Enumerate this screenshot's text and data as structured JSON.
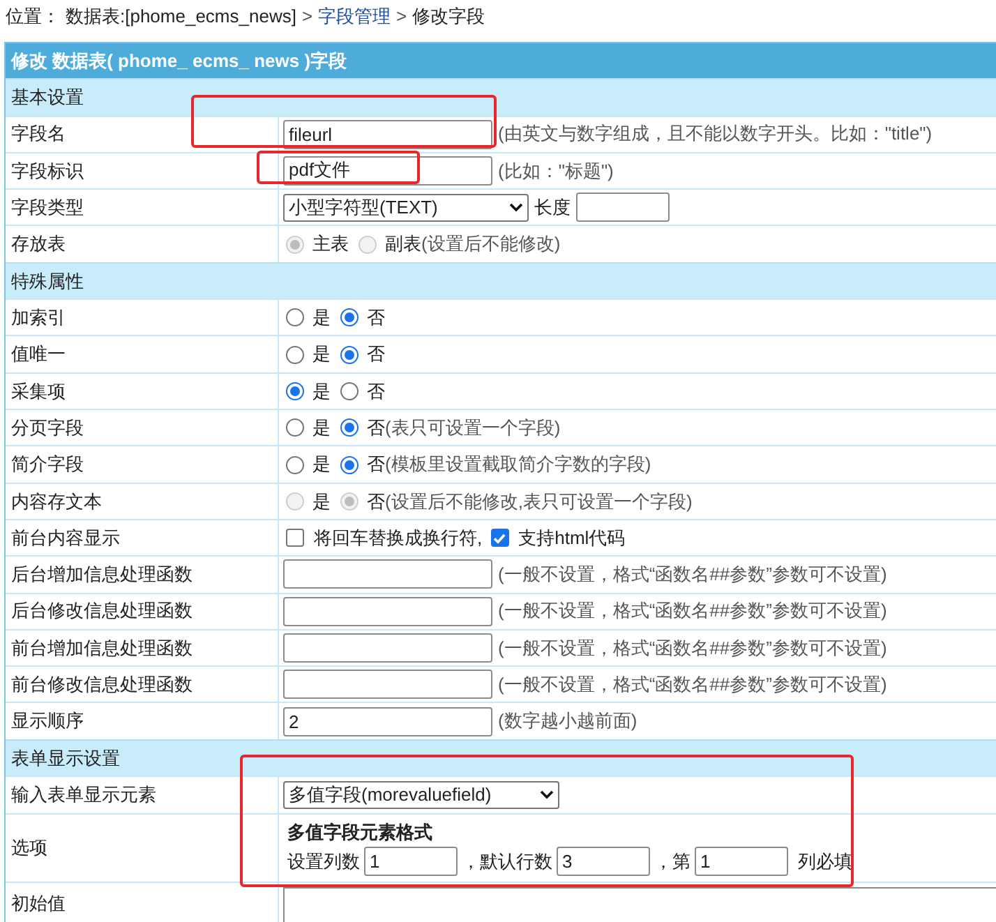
{
  "breadcrumb": {
    "prefix": "位置：",
    "separator": ">",
    "items": [
      {
        "text": "数据表:[phome_ecms_news]",
        "kind": "text"
      },
      {
        "text": "字段管理",
        "kind": "link"
      },
      {
        "text": "修改字段",
        "kind": "text"
      }
    ]
  },
  "form": {
    "title": "修改 数据表( phome_ ecms_ news )字段",
    "rows": [
      {
        "kind": "section",
        "label": "基本设置"
      },
      {
        "kind": "input",
        "label": "字段名",
        "value": "fileurl",
        "hint": "(由英文与数字组成，且不能以数字开头。比如：\"title\")"
      },
      {
        "kind": "input",
        "label": "字段标识",
        "value": "pdf文件",
        "hint": "(比如：\"标题\")"
      },
      {
        "kind": "select",
        "label": "字段类型",
        "value": "小型字符型(TEXT)",
        "extra_label": "长度"
      },
      {
        "kind": "radio",
        "label": "存放表",
        "disabled": true,
        "options": [
          {
            "label": "主表",
            "selected": true
          },
          {
            "label": "副表",
            "selected": false
          }
        ],
        "hint": "(设置后不能修改)"
      },
      {
        "kind": "section",
        "label": "特殊属性"
      },
      {
        "kind": "radio",
        "label": "加索引",
        "disabled": false,
        "options": [
          {
            "label": "是",
            "selected": false
          },
          {
            "label": "否",
            "selected": true
          }
        ]
      },
      {
        "kind": "radio",
        "label": "值唯一",
        "disabled": false,
        "options": [
          {
            "label": "是",
            "selected": false
          },
          {
            "label": "否",
            "selected": true
          }
        ]
      },
      {
        "kind": "radio",
        "label": "采集项",
        "disabled": false,
        "options": [
          {
            "label": "是",
            "selected": true
          },
          {
            "label": "否",
            "selected": false
          }
        ]
      },
      {
        "kind": "radio",
        "label": "分页字段",
        "disabled": false,
        "options": [
          {
            "label": "是",
            "selected": false
          },
          {
            "label": "否",
            "selected": true
          }
        ],
        "hint": "(表只可设置一个字段)"
      },
      {
        "kind": "radio",
        "label": "简介字段",
        "disabled": false,
        "options": [
          {
            "label": "是",
            "selected": false
          },
          {
            "label": "否",
            "selected": true
          }
        ],
        "hint": "(模板里设置截取简介字数的字段)"
      },
      {
        "kind": "radio",
        "label": "内容存文本",
        "disabled": true,
        "options": [
          {
            "label": "是",
            "selected": false
          },
          {
            "label": "否",
            "selected": true
          }
        ],
        "hint": "(设置后不能修改,表只可设置一个字段)"
      },
      {
        "kind": "checks",
        "label": "前台内容显示",
        "options": [
          {
            "label": "将回车替换成换行符,",
            "checked": false
          },
          {
            "label": "支持html代码",
            "checked": true
          }
        ]
      },
      {
        "kind": "input",
        "label": "后台增加信息处理函数",
        "hint": "(一般不设置，格式“函数名##参数”参数可不设置)"
      },
      {
        "kind": "input",
        "label": "后台修改信息处理函数",
        "hint": "(一般不设置，格式“函数名##参数”参数可不设置)"
      },
      {
        "kind": "input",
        "label": "前台增加信息处理函数",
        "hint": "(一般不设置，格式“函数名##参数”参数可不设置)"
      },
      {
        "kind": "input",
        "label": "前台修改信息处理函数",
        "hint": "(一般不设置，格式“函数名##参数”参数可不设置)"
      },
      {
        "kind": "input",
        "label": "显示顺序",
        "value": "2",
        "hint": "(数字越小越前面)"
      },
      {
        "kind": "section",
        "label": "表单显示设置"
      },
      {
        "kind": "select",
        "label": "输入表单显示元素",
        "value": "多值字段(morevaluefield)"
      },
      {
        "kind": "multivalue",
        "label": "选项",
        "title": "多值字段元素格式",
        "parts": [
          {
            "text": "设置列数",
            "value": "1"
          },
          {
            "text": "，默认行数",
            "value": "3"
          },
          {
            "text": "，第",
            "value": "1"
          }
        ],
        "suffix": "列必填"
      },
      {
        "kind": "textarea",
        "label": "初始值"
      }
    ]
  }
}
